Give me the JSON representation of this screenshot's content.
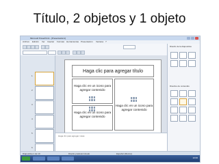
{
  "heading": "Título, 2 objetos y 1 objeto",
  "window": {
    "title": "Microsoft PowerPoint - [Presentación1]"
  },
  "menu": [
    "Archivo",
    "Edición",
    "Ver",
    "Insertar",
    "Formato",
    "Herramientas",
    "Presentación",
    "Ventana",
    "?"
  ],
  "thumbnails": [
    "1",
    "2",
    "3",
    "4",
    "5",
    "6"
  ],
  "slide": {
    "title_placeholder": "Haga clic para agregar título",
    "content_left_top": "Haga clic en un icono para agregar contenido",
    "content_left_bottom": "Haga clic en un icono para agregar contenido",
    "content_right": "Haga clic en un icono para agregar contenido"
  },
  "notes": "Haga clic para agregar notas",
  "task_pane": {
    "title": "Diseño de la diapositiva",
    "section": "Diseños de contenido"
  },
  "status": {
    "slide": "Diapositiva 1 de 10",
    "design": "Diseño predeterminado",
    "language": "Español (México)"
  },
  "taskbar": {
    "clock": "10:00"
  }
}
